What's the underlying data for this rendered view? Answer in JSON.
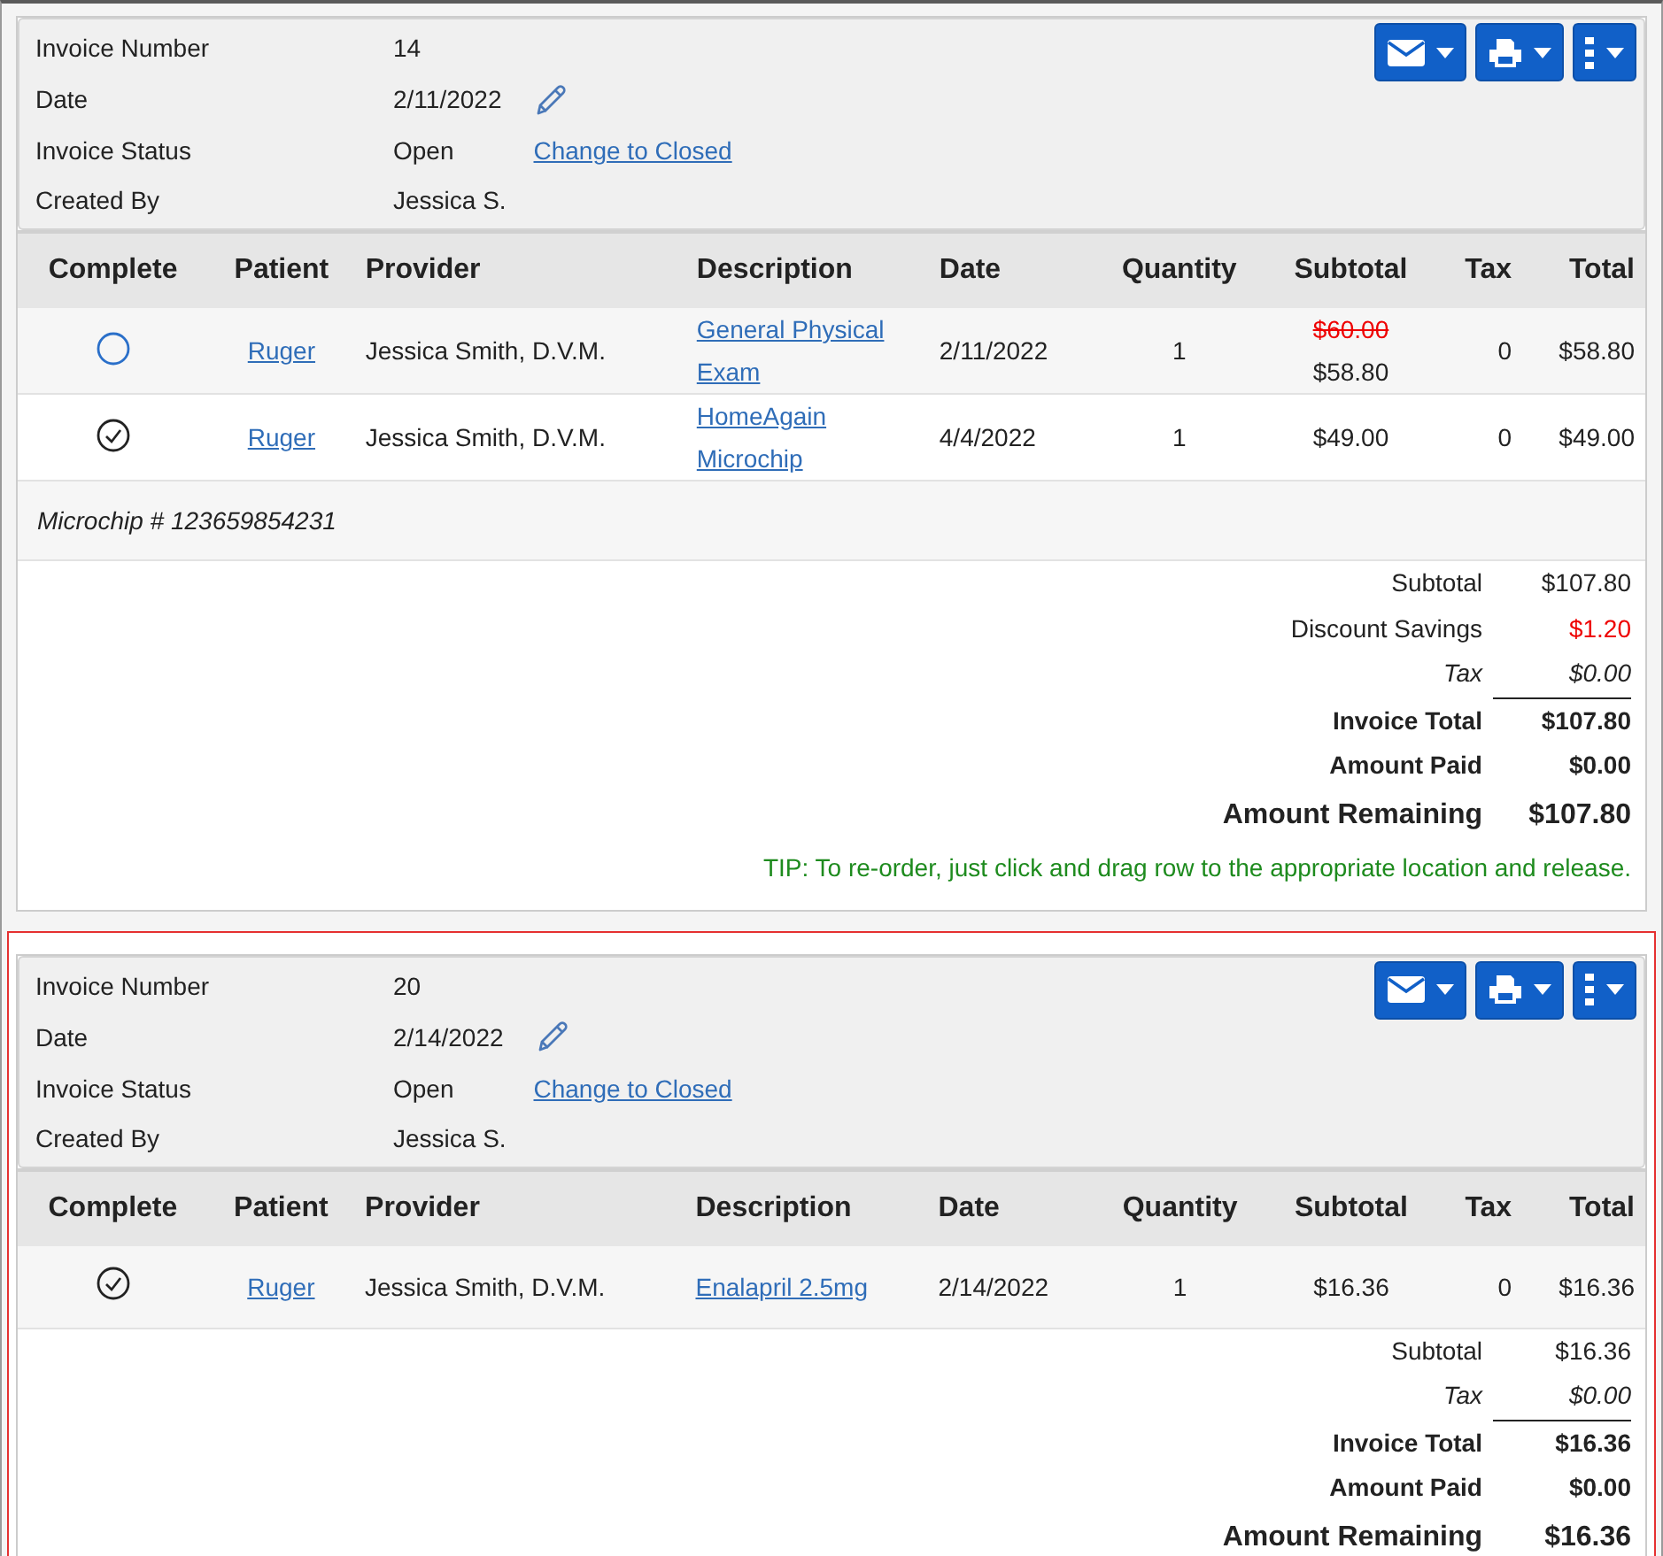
{
  "invoices": [
    {
      "selected": false,
      "number_label": "Invoice Number",
      "number": "14",
      "date_label": "Date",
      "date": "2/11/2022",
      "status_label": "Invoice Status",
      "status": "Open",
      "status_link": "Change to Closed",
      "created_label": "Created By",
      "created_by": "Jessica S.",
      "columns": [
        "Complete",
        "Patient",
        "Provider",
        "Description",
        "Date",
        "Quantity",
        "Subtotal",
        "Tax",
        "Total"
      ],
      "rows": [
        {
          "complete": false,
          "patient": "Ruger",
          "provider": "Jessica Smith, D.V.M.",
          "description": "General Physical Exam",
          "date": "2/11/2022",
          "quantity": "1",
          "subtotal_original": "$60.00",
          "subtotal": "$58.80",
          "tax": "0",
          "total": "$58.80"
        },
        {
          "complete": true,
          "patient": "Ruger",
          "provider": "Jessica Smith, D.V.M.",
          "description": "HomeAgain Microchip",
          "date": "4/4/2022",
          "quantity": "1",
          "subtotal": "$49.00",
          "tax": "0",
          "total": "$49.00",
          "note": "Microchip # 123659854231"
        }
      ],
      "summary": [
        {
          "kind": "plain",
          "label": "Subtotal",
          "value": "$107.80"
        },
        {
          "kind": "discount",
          "label": "Discount Savings",
          "value": "$1.20"
        },
        {
          "kind": "italic",
          "label": "Tax",
          "value": "$0.00"
        },
        {
          "kind": "bold",
          "label": "Invoice Total",
          "value": "$107.80"
        },
        {
          "kind": "bold",
          "label": "Amount Paid",
          "value": "$0.00"
        },
        {
          "kind": "grand",
          "label": "Amount Remaining",
          "value": "$107.80"
        }
      ],
      "tip": "TIP: To re-order, just click and drag row to the appropriate location and release."
    },
    {
      "selected": true,
      "number_label": "Invoice Number",
      "number": "20",
      "date_label": "Date",
      "date": "2/14/2022",
      "status_label": "Invoice Status",
      "status": "Open",
      "status_link": "Change to Closed",
      "created_label": "Created By",
      "created_by": "Jessica S.",
      "columns": [
        "Complete",
        "Patient",
        "Provider",
        "Description",
        "Date",
        "Quantity",
        "Subtotal",
        "Tax",
        "Total"
      ],
      "rows": [
        {
          "complete": true,
          "patient": "Ruger",
          "provider": "Jessica Smith, D.V.M.",
          "description": "Enalapril 2.5mg",
          "date": "2/14/2022",
          "quantity": "1",
          "subtotal": "$16.36",
          "tax": "0",
          "total": "$16.36"
        }
      ],
      "summary": [
        {
          "kind": "plain",
          "label": "Subtotal",
          "value": "$16.36"
        },
        {
          "kind": "italic",
          "label": "Tax",
          "value": "$0.00"
        },
        {
          "kind": "bold",
          "label": "Invoice Total",
          "value": "$16.36"
        },
        {
          "kind": "bold",
          "label": "Amount Paid",
          "value": "$0.00"
        },
        {
          "kind": "grand",
          "label": "Amount Remaining",
          "value": "$16.36"
        }
      ]
    }
  ]
}
